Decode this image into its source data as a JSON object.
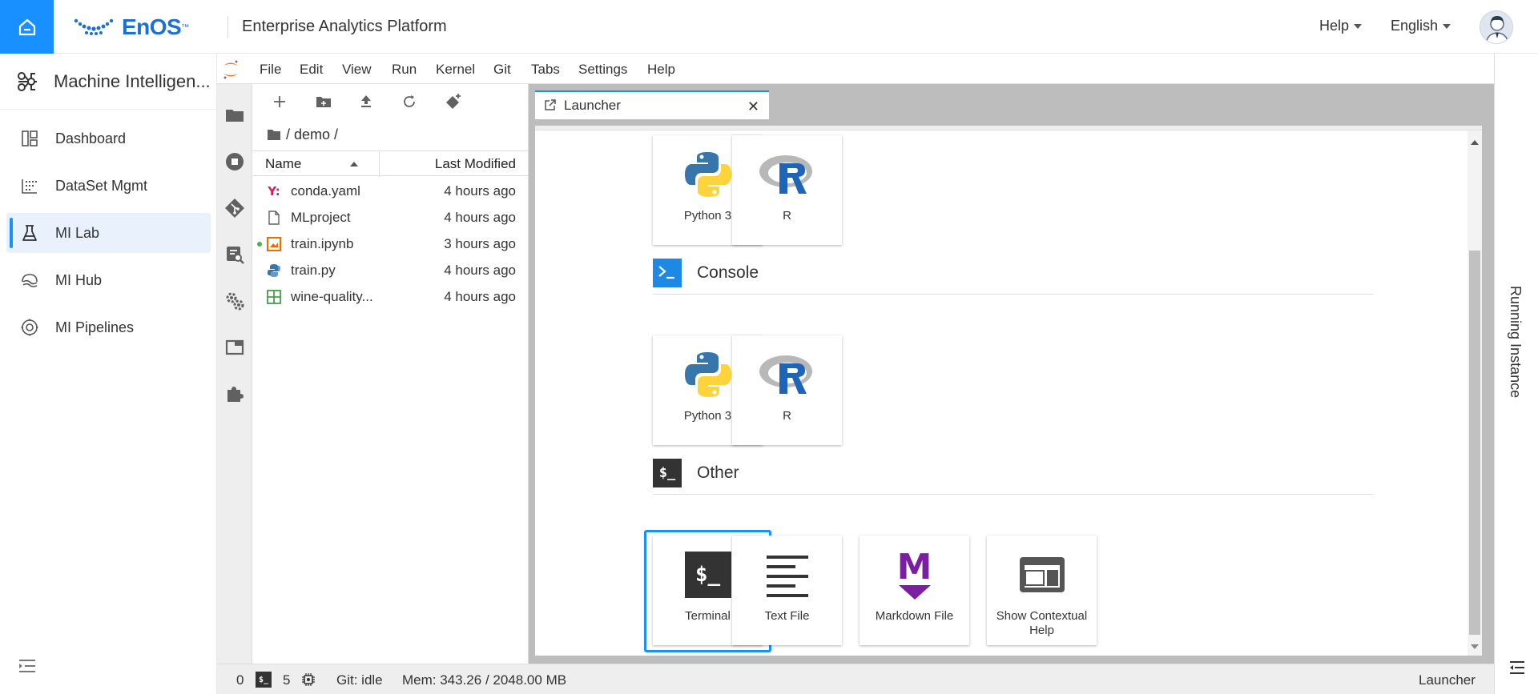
{
  "header": {
    "logo_text": "EnOS",
    "logo_tm": "™",
    "platform_title": "Enterprise Analytics Platform",
    "help_label": "Help",
    "language_label": "English"
  },
  "sidebar": {
    "app_title": "Machine Intelligen...",
    "items": [
      {
        "label": "Dashboard",
        "icon": "dashboard-icon"
      },
      {
        "label": "DataSet Mgmt",
        "icon": "dataset-icon"
      },
      {
        "label": "MI Lab",
        "icon": "flask-icon",
        "active": true
      },
      {
        "label": "MI Hub",
        "icon": "hub-icon"
      },
      {
        "label": "MI Pipelines",
        "icon": "pipelines-icon"
      }
    ]
  },
  "jupyter": {
    "menu": [
      "File",
      "Edit",
      "View",
      "Run",
      "Kernel",
      "Git",
      "Tabs",
      "Settings",
      "Help"
    ],
    "breadcrumb": "/ demo /",
    "columns": {
      "name": "Name",
      "modified": "Last Modified"
    },
    "files": [
      {
        "name": "conda.yaml",
        "modified": "4 hours ago",
        "type": "yaml"
      },
      {
        "name": "MLproject",
        "modified": "4 hours ago",
        "type": "file"
      },
      {
        "name": "train.ipynb",
        "modified": "3 hours ago",
        "type": "notebook",
        "running": true
      },
      {
        "name": "train.py",
        "modified": "4 hours ago",
        "type": "python"
      },
      {
        "name": "wine-quality...",
        "modified": "4 hours ago",
        "type": "csv"
      }
    ],
    "tab": {
      "label": "Launcher",
      "close": "✕"
    },
    "launcher": {
      "notebook_cards": [
        {
          "label": "Python 3"
        },
        {
          "label": "R"
        }
      ],
      "console_section": "Console",
      "console_cards": [
        {
          "label": "Python 3"
        },
        {
          "label": "R"
        }
      ],
      "other_section": "Other",
      "other_icon_text": "$_",
      "other_cards": [
        {
          "label": "Terminal",
          "icon_text": "$_"
        },
        {
          "label": "Text File"
        },
        {
          "label": "Markdown File",
          "icon_text": "M"
        },
        {
          "label": "Show Contextual Help"
        }
      ]
    },
    "status": {
      "terminals": "0",
      "kernels": "5",
      "git": "Git: idle",
      "memory": "Mem: 343.26 / 2048.00 MB",
      "current": "Launcher"
    }
  },
  "right_panel": {
    "label": "Running Instance"
  },
  "colors": {
    "accent": "#1890ff",
    "brand": "#1d6fd8",
    "markdown": "#7b1fa2",
    "python_blue": "#3776ab",
    "python_yellow": "#ffd43b",
    "r_blue": "#1f65b7"
  }
}
